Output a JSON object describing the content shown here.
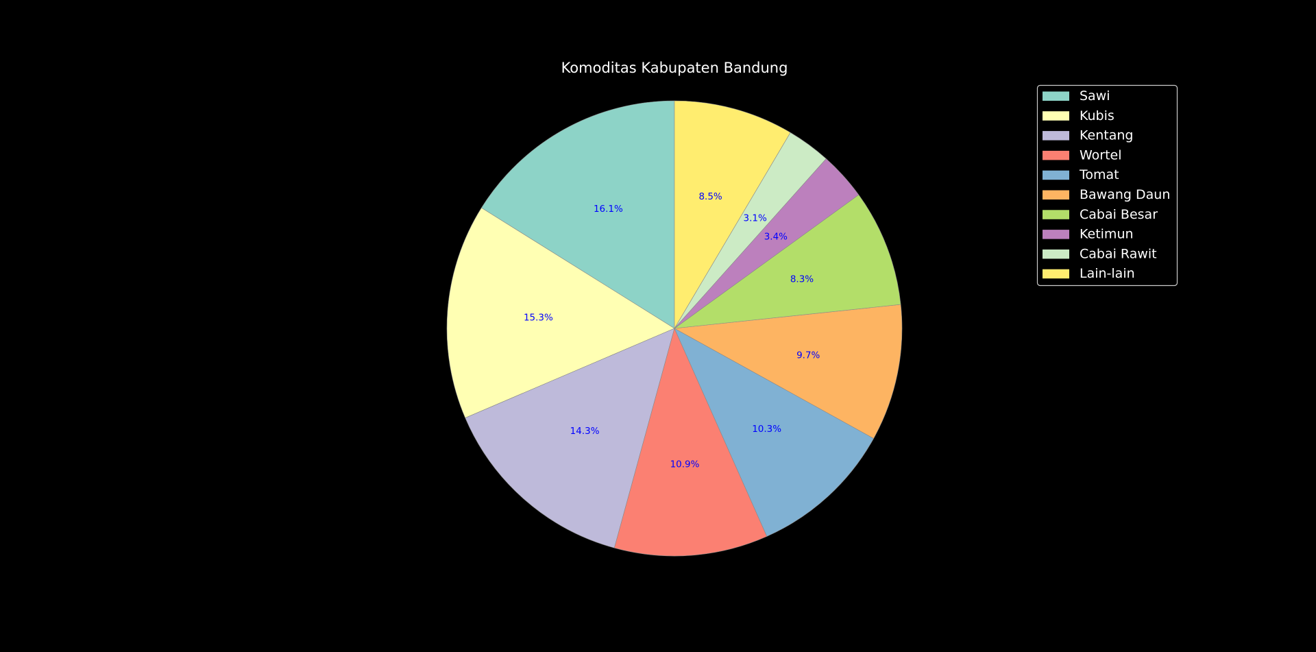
{
  "chart_data": {
    "type": "pie",
    "title": "Komoditas Kabupaten Bandung",
    "categories": [
      "Sawi",
      "Kubis",
      "Kentang",
      "Wortel",
      "Tomat",
      "Bawang Daun",
      "Cabai Besar",
      "Ketimun",
      "Cabai Rawit",
      "Lain-lain"
    ],
    "values": [
      16.1,
      15.3,
      14.3,
      10.9,
      10.3,
      9.7,
      8.3,
      3.4,
      3.1,
      8.5
    ],
    "labels": [
      "16.1%",
      "15.3%",
      "14.3%",
      "10.9%",
      "10.3%",
      "9.7%",
      "8.3%",
      "3.4%",
      "3.1%",
      "8.5%"
    ],
    "colors": [
      "#8dd3c7",
      "#ffffb3",
      "#bebada",
      "#fb8072",
      "#80b1d3",
      "#fdb462",
      "#b3de69",
      "#bc80bd",
      "#ccebc5",
      "#ffed6f"
    ],
    "start_angle": 90,
    "direction": "counterclockwise",
    "label_color": "#0000ff",
    "legend_placement": "upper-right",
    "background": "#000000"
  }
}
